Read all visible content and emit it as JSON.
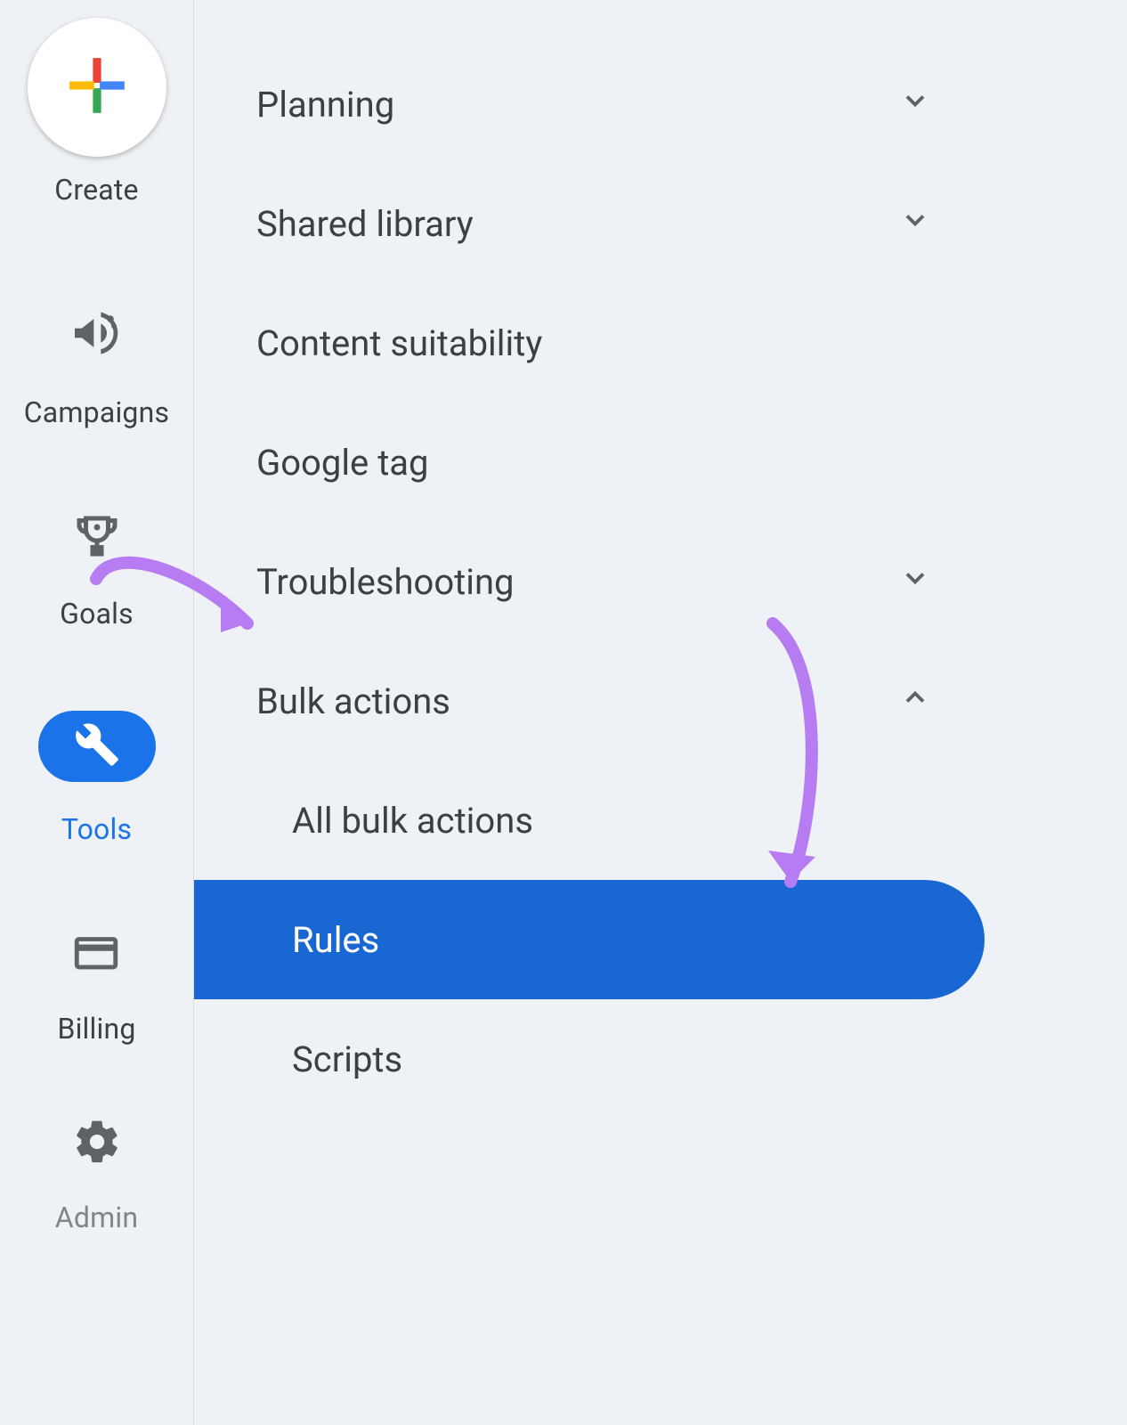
{
  "rail": {
    "create": "Create",
    "items": [
      {
        "id": "campaigns",
        "label": "Campaigns"
      },
      {
        "id": "goals",
        "label": "Goals"
      },
      {
        "id": "tools",
        "label": "Tools",
        "active": true
      },
      {
        "id": "billing",
        "label": "Billing"
      },
      {
        "id": "admin",
        "label": "Admin"
      }
    ]
  },
  "menu": {
    "items": [
      {
        "id": "planning",
        "label": "Planning",
        "expandable": true,
        "expanded": false
      },
      {
        "id": "shared",
        "label": "Shared library",
        "expandable": true,
        "expanded": false
      },
      {
        "id": "content",
        "label": "Content suitability",
        "expandable": false
      },
      {
        "id": "gtag",
        "label": "Google tag",
        "expandable": false
      },
      {
        "id": "trouble",
        "label": "Troubleshooting",
        "expandable": true,
        "expanded": false
      },
      {
        "id": "bulk",
        "label": "Bulk actions",
        "expandable": true,
        "expanded": true,
        "children": [
          {
            "id": "allbulk",
            "label": "All bulk actions"
          },
          {
            "id": "rules",
            "label": "Rules",
            "selected": true
          },
          {
            "id": "scripts",
            "label": "Scripts"
          }
        ]
      }
    ]
  }
}
